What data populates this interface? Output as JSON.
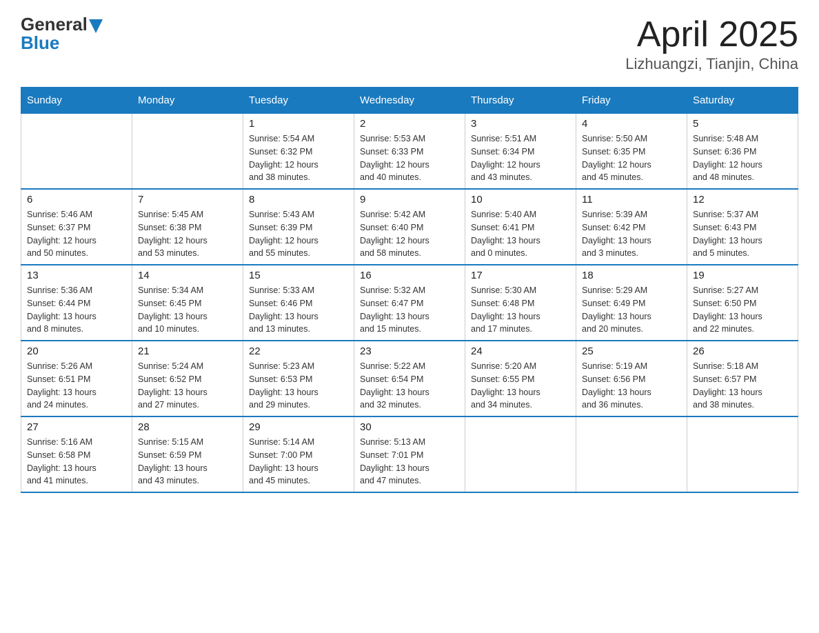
{
  "logo": {
    "text_general": "General",
    "text_blue": "Blue"
  },
  "title": "April 2025",
  "subtitle": "Lizhuangzi, Tianjin, China",
  "days_of_week": [
    "Sunday",
    "Monday",
    "Tuesday",
    "Wednesday",
    "Thursday",
    "Friday",
    "Saturday"
  ],
  "weeks": [
    [
      {
        "day": "",
        "info": ""
      },
      {
        "day": "",
        "info": ""
      },
      {
        "day": "1",
        "info": "Sunrise: 5:54 AM\nSunset: 6:32 PM\nDaylight: 12 hours\nand 38 minutes."
      },
      {
        "day": "2",
        "info": "Sunrise: 5:53 AM\nSunset: 6:33 PM\nDaylight: 12 hours\nand 40 minutes."
      },
      {
        "day": "3",
        "info": "Sunrise: 5:51 AM\nSunset: 6:34 PM\nDaylight: 12 hours\nand 43 minutes."
      },
      {
        "day": "4",
        "info": "Sunrise: 5:50 AM\nSunset: 6:35 PM\nDaylight: 12 hours\nand 45 minutes."
      },
      {
        "day": "5",
        "info": "Sunrise: 5:48 AM\nSunset: 6:36 PM\nDaylight: 12 hours\nand 48 minutes."
      }
    ],
    [
      {
        "day": "6",
        "info": "Sunrise: 5:46 AM\nSunset: 6:37 PM\nDaylight: 12 hours\nand 50 minutes."
      },
      {
        "day": "7",
        "info": "Sunrise: 5:45 AM\nSunset: 6:38 PM\nDaylight: 12 hours\nand 53 minutes."
      },
      {
        "day": "8",
        "info": "Sunrise: 5:43 AM\nSunset: 6:39 PM\nDaylight: 12 hours\nand 55 minutes."
      },
      {
        "day": "9",
        "info": "Sunrise: 5:42 AM\nSunset: 6:40 PM\nDaylight: 12 hours\nand 58 minutes."
      },
      {
        "day": "10",
        "info": "Sunrise: 5:40 AM\nSunset: 6:41 PM\nDaylight: 13 hours\nand 0 minutes."
      },
      {
        "day": "11",
        "info": "Sunrise: 5:39 AM\nSunset: 6:42 PM\nDaylight: 13 hours\nand 3 minutes."
      },
      {
        "day": "12",
        "info": "Sunrise: 5:37 AM\nSunset: 6:43 PM\nDaylight: 13 hours\nand 5 minutes."
      }
    ],
    [
      {
        "day": "13",
        "info": "Sunrise: 5:36 AM\nSunset: 6:44 PM\nDaylight: 13 hours\nand 8 minutes."
      },
      {
        "day": "14",
        "info": "Sunrise: 5:34 AM\nSunset: 6:45 PM\nDaylight: 13 hours\nand 10 minutes."
      },
      {
        "day": "15",
        "info": "Sunrise: 5:33 AM\nSunset: 6:46 PM\nDaylight: 13 hours\nand 13 minutes."
      },
      {
        "day": "16",
        "info": "Sunrise: 5:32 AM\nSunset: 6:47 PM\nDaylight: 13 hours\nand 15 minutes."
      },
      {
        "day": "17",
        "info": "Sunrise: 5:30 AM\nSunset: 6:48 PM\nDaylight: 13 hours\nand 17 minutes."
      },
      {
        "day": "18",
        "info": "Sunrise: 5:29 AM\nSunset: 6:49 PM\nDaylight: 13 hours\nand 20 minutes."
      },
      {
        "day": "19",
        "info": "Sunrise: 5:27 AM\nSunset: 6:50 PM\nDaylight: 13 hours\nand 22 minutes."
      }
    ],
    [
      {
        "day": "20",
        "info": "Sunrise: 5:26 AM\nSunset: 6:51 PM\nDaylight: 13 hours\nand 24 minutes."
      },
      {
        "day": "21",
        "info": "Sunrise: 5:24 AM\nSunset: 6:52 PM\nDaylight: 13 hours\nand 27 minutes."
      },
      {
        "day": "22",
        "info": "Sunrise: 5:23 AM\nSunset: 6:53 PM\nDaylight: 13 hours\nand 29 minutes."
      },
      {
        "day": "23",
        "info": "Sunrise: 5:22 AM\nSunset: 6:54 PM\nDaylight: 13 hours\nand 32 minutes."
      },
      {
        "day": "24",
        "info": "Sunrise: 5:20 AM\nSunset: 6:55 PM\nDaylight: 13 hours\nand 34 minutes."
      },
      {
        "day": "25",
        "info": "Sunrise: 5:19 AM\nSunset: 6:56 PM\nDaylight: 13 hours\nand 36 minutes."
      },
      {
        "day": "26",
        "info": "Sunrise: 5:18 AM\nSunset: 6:57 PM\nDaylight: 13 hours\nand 38 minutes."
      }
    ],
    [
      {
        "day": "27",
        "info": "Sunrise: 5:16 AM\nSunset: 6:58 PM\nDaylight: 13 hours\nand 41 minutes."
      },
      {
        "day": "28",
        "info": "Sunrise: 5:15 AM\nSunset: 6:59 PM\nDaylight: 13 hours\nand 43 minutes."
      },
      {
        "day": "29",
        "info": "Sunrise: 5:14 AM\nSunset: 7:00 PM\nDaylight: 13 hours\nand 45 minutes."
      },
      {
        "day": "30",
        "info": "Sunrise: 5:13 AM\nSunset: 7:01 PM\nDaylight: 13 hours\nand 47 minutes."
      },
      {
        "day": "",
        "info": ""
      },
      {
        "day": "",
        "info": ""
      },
      {
        "day": "",
        "info": ""
      }
    ]
  ]
}
